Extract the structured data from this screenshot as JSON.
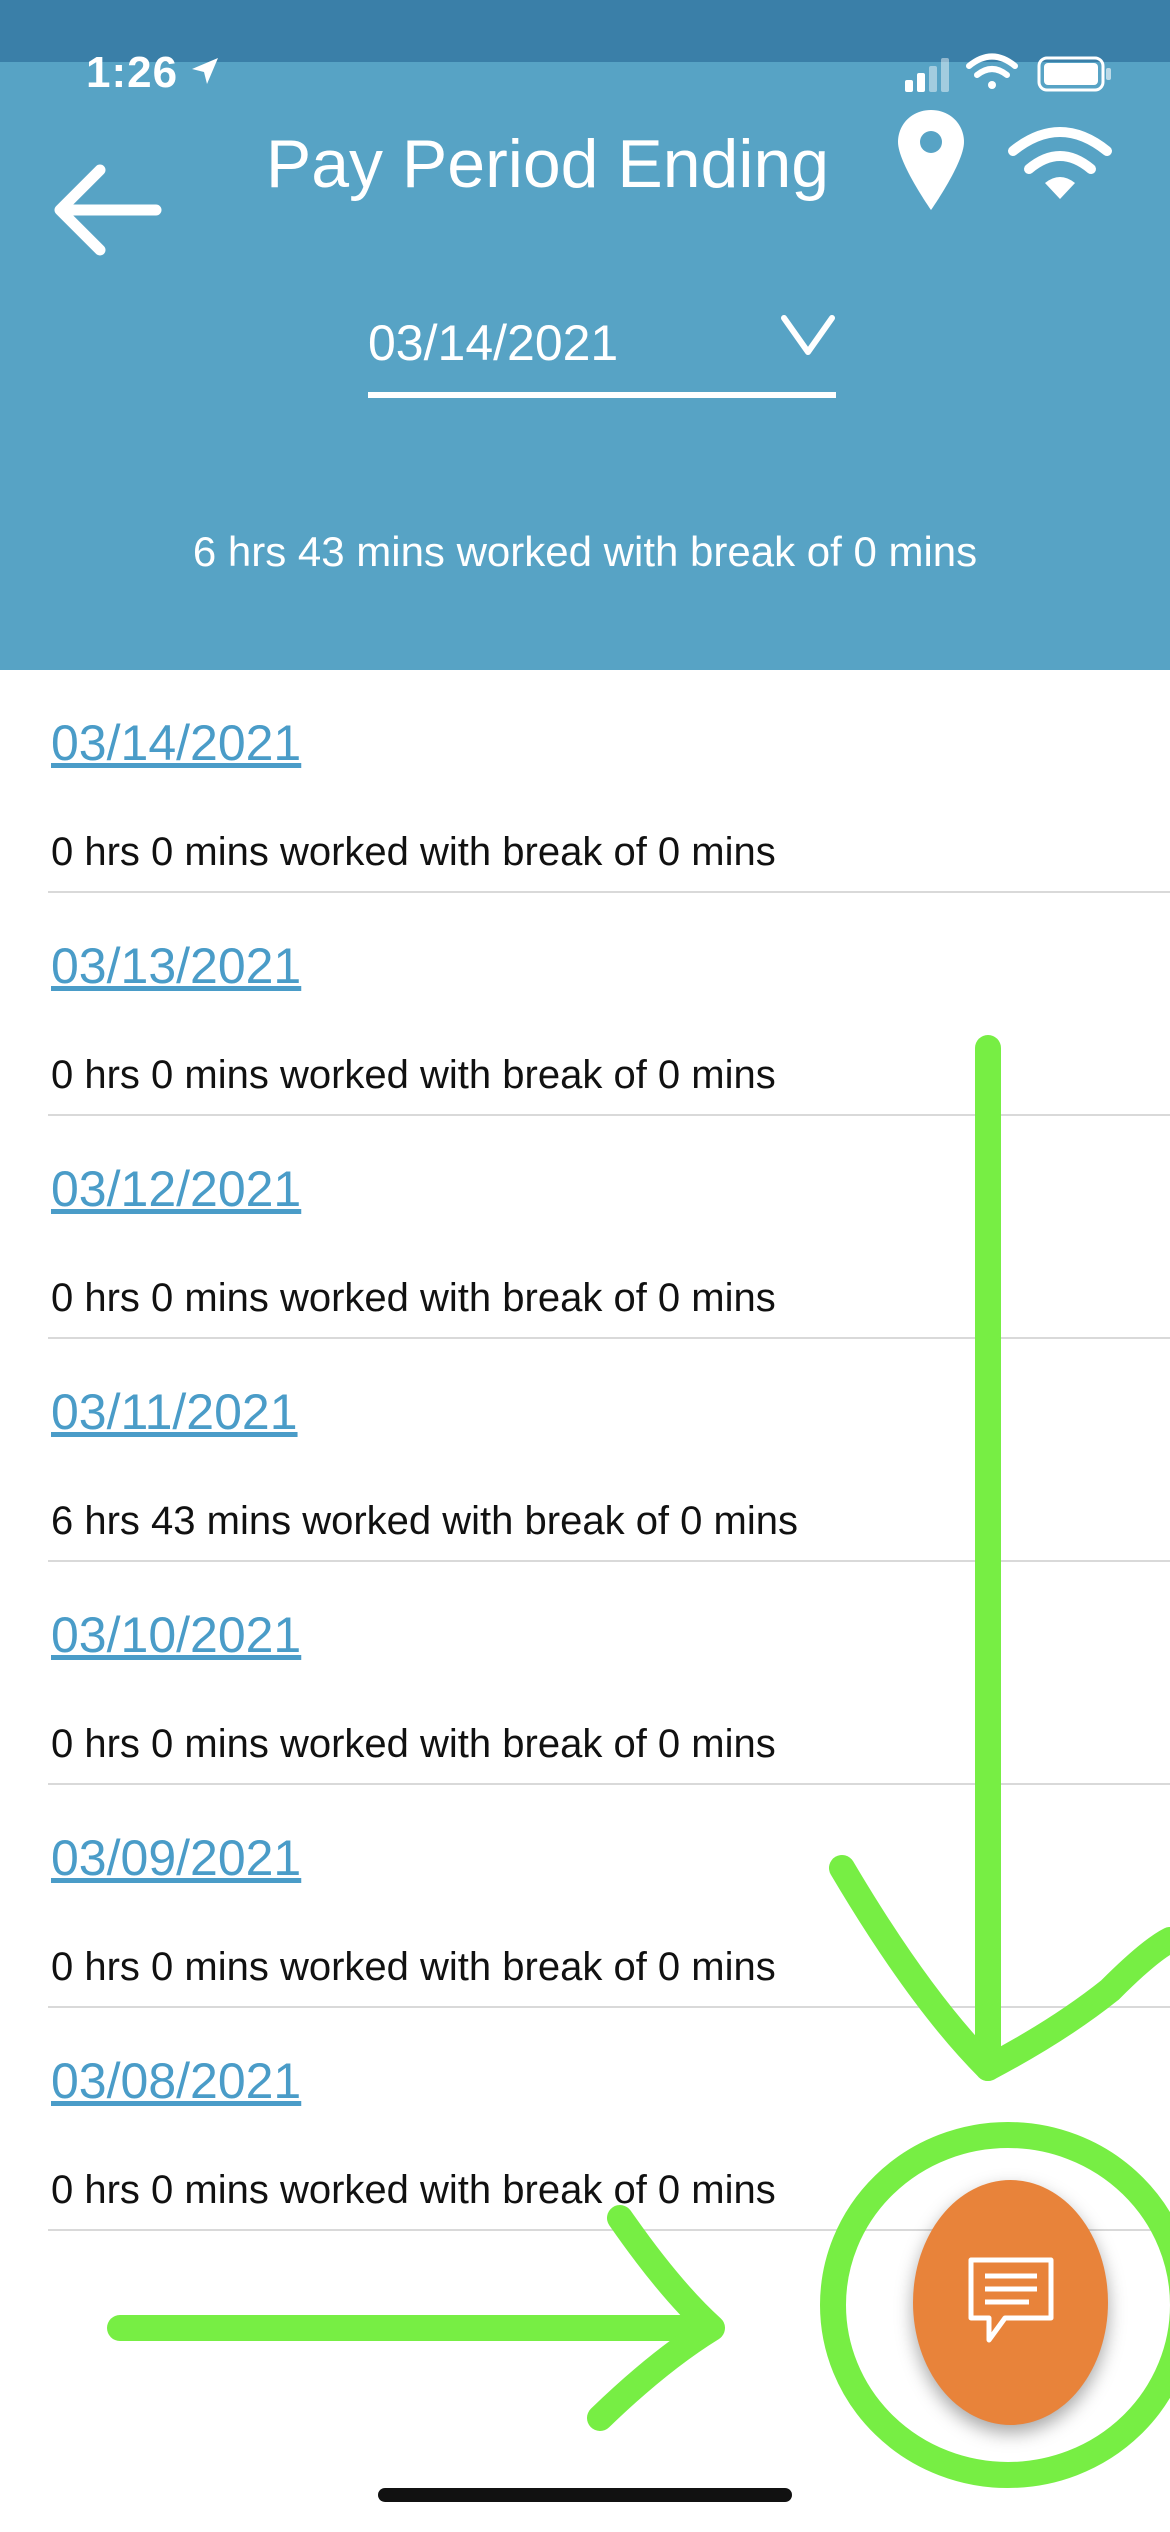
{
  "status_bar": {
    "time": "1:26"
  },
  "header": {
    "title": "Pay Period Ending",
    "period": {
      "selected": "03/14/2021"
    },
    "summary": "6 hrs 43 mins worked with break of 0 mins"
  },
  "days": [
    {
      "date": "03/14/2021",
      "summary": "0 hrs 0 mins worked with break of 0 mins"
    },
    {
      "date": "03/13/2021",
      "summary": "0 hrs 0 mins worked with break of 0 mins"
    },
    {
      "date": "03/12/2021",
      "summary": "0 hrs 0 mins worked with break of 0 mins"
    },
    {
      "date": "03/11/2021",
      "summary": "6 hrs 43 mins worked with break of 0 mins"
    },
    {
      "date": "03/10/2021",
      "summary": "0 hrs 0 mins worked with break of 0 mins"
    },
    {
      "date": "03/09/2021",
      "summary": "0 hrs 0 mins worked with break of 0 mins"
    },
    {
      "date": "03/08/2021",
      "summary": "0 hrs 0 mins worked with break of 0 mins"
    }
  ],
  "icons": {
    "back": "arrow-left-icon",
    "location": "map-pin-icon",
    "wifi": "wifi-icon",
    "chevron": "chevron-down-icon",
    "chat": "chat-bubble-icon"
  },
  "colors": {
    "header": "#57a3c5",
    "status_strip": "#3a7fa8",
    "link": "#4a9cc8",
    "fab": "#e8833a",
    "annotation": "#77ee44"
  }
}
